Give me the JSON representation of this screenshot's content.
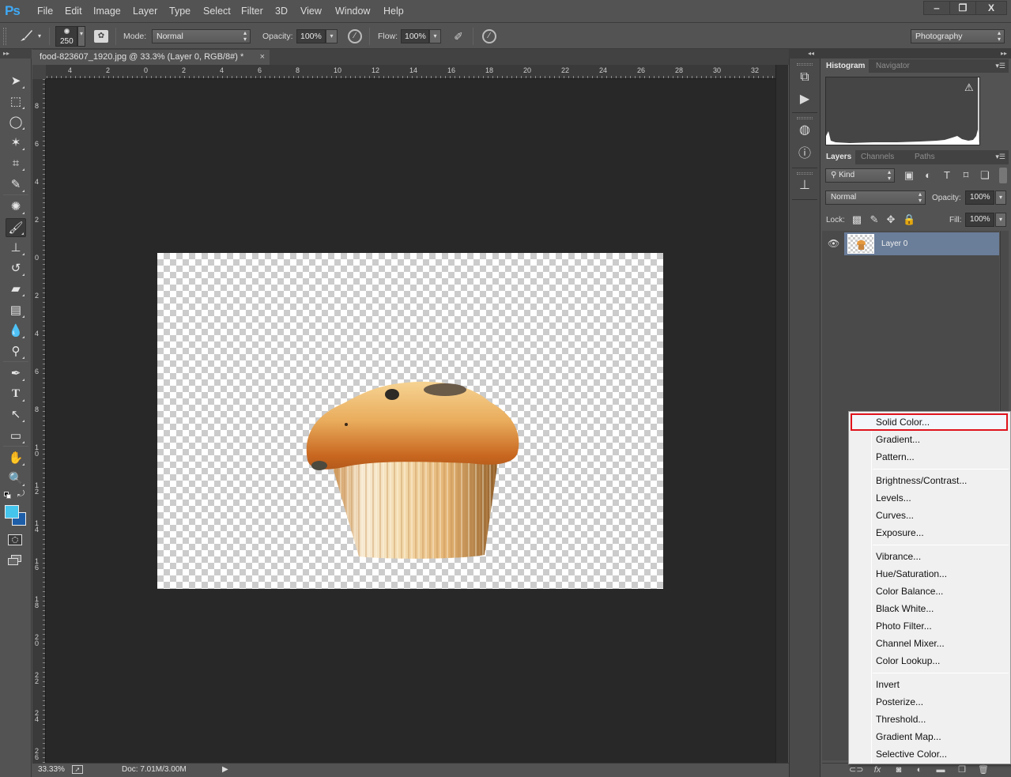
{
  "app": {
    "logo": "Ps"
  },
  "menu": [
    "File",
    "Edit",
    "Image",
    "Layer",
    "Type",
    "Select",
    "Filter",
    "3D",
    "View",
    "Window",
    "Help"
  ],
  "window_controls": {
    "minimize": "‒",
    "restore": "❐",
    "close": "X"
  },
  "options_bar": {
    "brush_size": "250",
    "mode_label": "Mode:",
    "mode_value": "Normal",
    "opacity_label": "Opacity:",
    "opacity_value": "100%",
    "flow_label": "Flow:",
    "flow_value": "100%",
    "workspace": "Photography"
  },
  "document": {
    "tab_title": "food-823607_1920.jpg @ 33.3% (Layer 0, RGB/8#) *",
    "close_glyph": "×"
  },
  "rulers": {
    "horizontal": [
      "4",
      "2",
      "0",
      "2",
      "4",
      "6",
      "8",
      "10",
      "12",
      "14",
      "16",
      "18",
      "20",
      "22",
      "24",
      "26",
      "28",
      "30",
      "32"
    ],
    "vertical": [
      "8",
      "6",
      "4",
      "2",
      "0",
      "2",
      "4",
      "6",
      "8",
      "10",
      "12",
      "14",
      "16",
      "18",
      "20",
      "22",
      "24",
      "26"
    ]
  },
  "tools": [
    {
      "id": "move",
      "glyph": "➤"
    },
    {
      "id": "rectangular-marquee",
      "glyph": "⬚"
    },
    {
      "id": "lasso",
      "glyph": "◯"
    },
    {
      "id": "magic-wand",
      "glyph": "✶"
    },
    {
      "id": "crop",
      "glyph": "⌗"
    },
    {
      "id": "eyedropper",
      "glyph": "✎"
    },
    {
      "id": "spot-healing",
      "glyph": "✺"
    },
    {
      "id": "brush",
      "glyph": "🖌",
      "active": true
    },
    {
      "id": "clone-stamp",
      "glyph": "⊥"
    },
    {
      "id": "history-brush",
      "glyph": "↺"
    },
    {
      "id": "eraser",
      "glyph": "▰"
    },
    {
      "id": "gradient",
      "glyph": "▤"
    },
    {
      "id": "blur",
      "glyph": "💧"
    },
    {
      "id": "dodge",
      "glyph": "⚲"
    },
    {
      "id": "pen",
      "glyph": "✒"
    },
    {
      "id": "type",
      "glyph": "T"
    },
    {
      "id": "path-selection",
      "glyph": "↖"
    },
    {
      "id": "rectangle-shape",
      "glyph": "▭"
    },
    {
      "id": "hand",
      "glyph": "✋"
    },
    {
      "id": "zoom",
      "glyph": "🔍"
    }
  ],
  "colors": {
    "foreground": "#45c4ec",
    "background": "#1e5ea8",
    "menu_highlight_border": "#e0121c",
    "selected_layer": "#6a7d99"
  },
  "status": {
    "zoom": "33.33%",
    "doc": "Doc: 7.01M/3.00M"
  },
  "histogram_panel": {
    "tabs": [
      "Histogram",
      "Navigator"
    ],
    "active_tab": "Histogram",
    "warning_glyph": "⚠"
  },
  "layers_panel": {
    "tabs": [
      "Layers",
      "Channels",
      "Paths"
    ],
    "active_tab": "Layers",
    "filter_value": "Kind",
    "blend_mode": "Normal",
    "opacity_label": "Opacity:",
    "opacity_value": "100%",
    "lock_label": "Lock:",
    "fill_label": "Fill:",
    "fill_value": "100%",
    "layers": [
      {
        "name": "Layer 0",
        "visible": true,
        "selected": true
      }
    ]
  },
  "adjustment_menu": {
    "highlighted": "Solid Color...",
    "items": [
      "Solid Color...",
      "Gradient...",
      "Pattern...",
      "Brightness/Contrast...",
      "Levels...",
      "Curves...",
      "Exposure...",
      "Vibrance...",
      "Hue/Saturation...",
      "Color Balance...",
      "Black  White...",
      "Photo Filter...",
      "Channel Mixer...",
      "Color Lookup...",
      "Invert",
      "Posterize...",
      "Threshold...",
      "Gradient Map...",
      "Selective Color..."
    ]
  }
}
